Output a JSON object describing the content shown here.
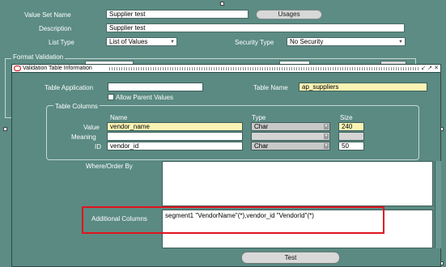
{
  "value_set_form": {
    "value_set_name_label": "Value Set Name",
    "value_set_name_value": "Supplier test",
    "usages_button": "Usages",
    "description_label": "Description",
    "description_value": "Supplier test",
    "list_type_label": "List Type",
    "list_type_value": "List of Values",
    "security_type_label": "Security Type",
    "security_type_value": "No Security",
    "format_validation_label": "Format Validation"
  },
  "window": {
    "title": "Validation Table Information",
    "table_application_label": "Table Application",
    "table_application_value": "",
    "table_name_label": "Table Name",
    "table_name_value": "ap_suppliers",
    "allow_parent_values_label": "Allow Parent Values",
    "table_columns_label": "Table Columns",
    "col_headers": {
      "name": "Name",
      "type": "Type",
      "size": "Size"
    },
    "rows": [
      {
        "label": "Value",
        "name": "vendor_name",
        "type": "Char",
        "size": "240"
      },
      {
        "label": "Meaning",
        "name": "",
        "type": "",
        "size": ""
      },
      {
        "label": "ID",
        "name": "vendor_id",
        "type": "Char",
        "size": "50"
      }
    ],
    "where_order_by_label": "Where/Order By",
    "where_order_by_value": "",
    "additional_columns_label": "Additional Columns",
    "additional_columns_value": "segment1 \"VendorName\"(*),vendor_id \"VendorId\"(*)",
    "test_button": "Test"
  }
}
